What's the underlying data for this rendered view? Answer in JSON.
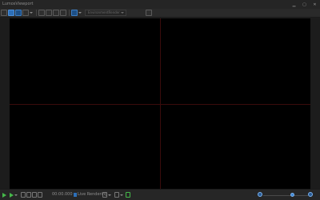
{
  "window": {
    "title": "LumosViewport",
    "buttons": [
      "minimize",
      "maximize",
      "close"
    ]
  },
  "toolbar": {
    "buttons": [
      {
        "icon": "select-icon",
        "active": false
      },
      {
        "icon": "move-icon",
        "active": true
      },
      {
        "icon": "rotate-icon",
        "active": false
      },
      {
        "icon": "grid-icon",
        "active": false
      },
      {
        "icon": "camera-icon",
        "active": false
      },
      {
        "icon": "light-icon",
        "active": false
      },
      {
        "icon": "undo-icon",
        "active": false
      },
      {
        "icon": "redo-icon",
        "active": false
      },
      {
        "icon": "scene-icon",
        "active": false
      },
      {
        "icon": "tools-icon",
        "active": false
      }
    ],
    "combo_value": "EnvironmentRender",
    "screenshot_icon": "screenshot-icon"
  },
  "statusbar": {
    "time": "00:00.000",
    "live_label": "Live Rendering",
    "zoom_value": 0.65
  }
}
